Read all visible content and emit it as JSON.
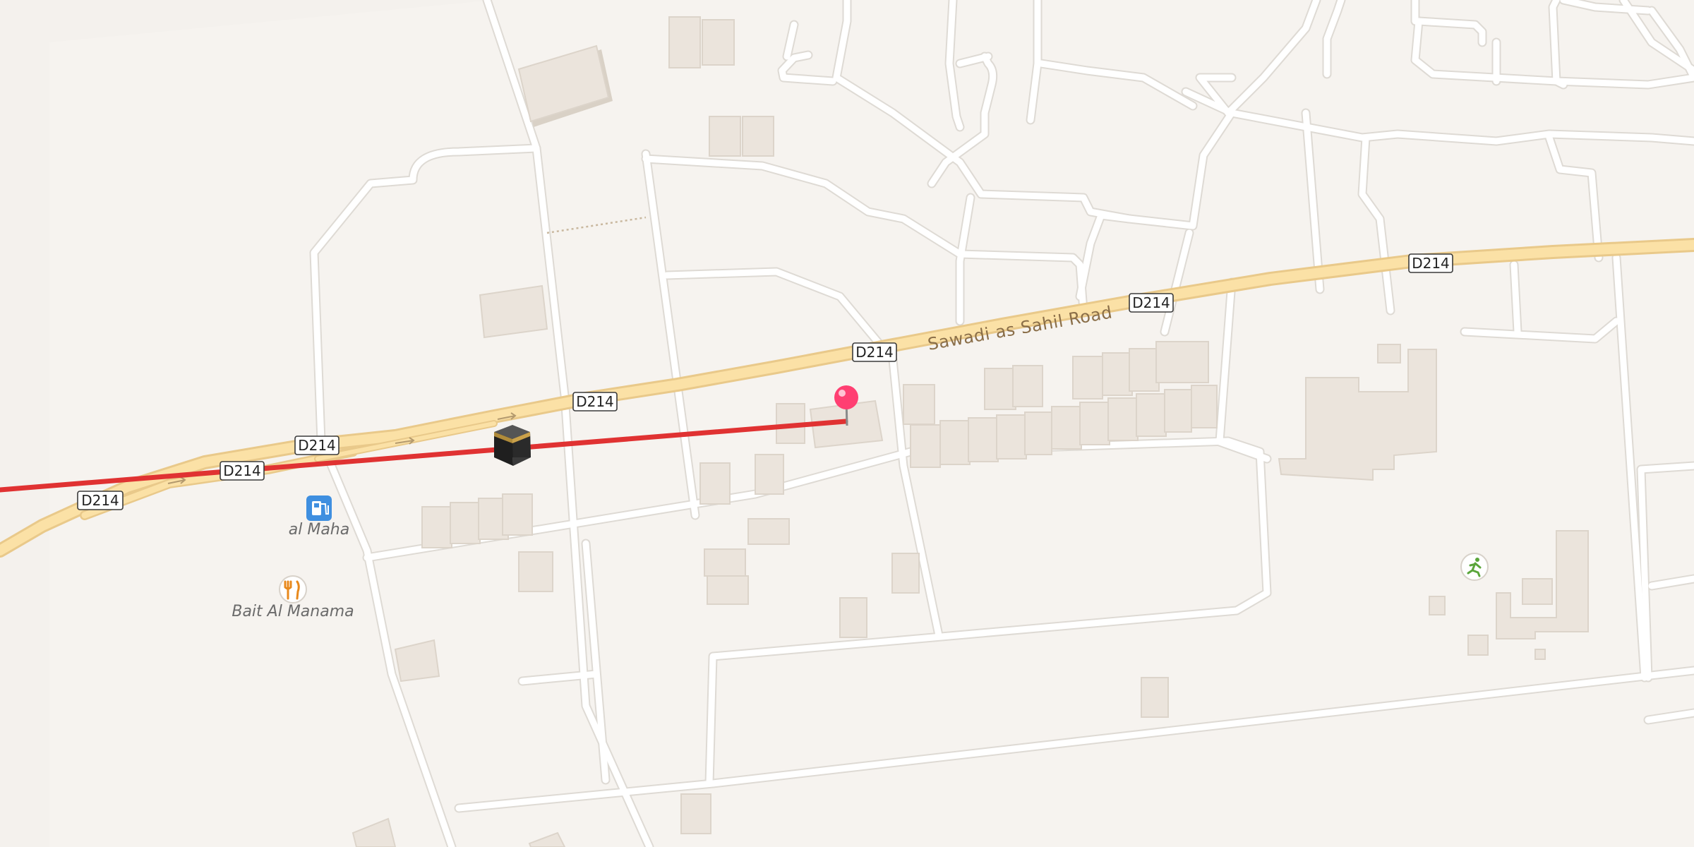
{
  "map": {
    "highway": {
      "name": "Sawadi as Sahil Road",
      "ref": "D214",
      "casing_color": "#e9c98a",
      "fill_color": "#fbe1a6"
    },
    "route_line_color": "#e03232",
    "pin_color": "#ff3f72",
    "pois": {
      "fuel": {
        "label": "al Maha",
        "icon": "fuel-pump-icon",
        "color": "#3f8fe0"
      },
      "restaurant": {
        "label": "Bait Al Manama",
        "icon": "fork-knife-icon",
        "color": "#e8891c"
      },
      "sports": {
        "icon": "running-person-icon",
        "color": "#5aa53a"
      },
      "kaaba": {
        "icon": "kaaba-icon"
      }
    }
  }
}
